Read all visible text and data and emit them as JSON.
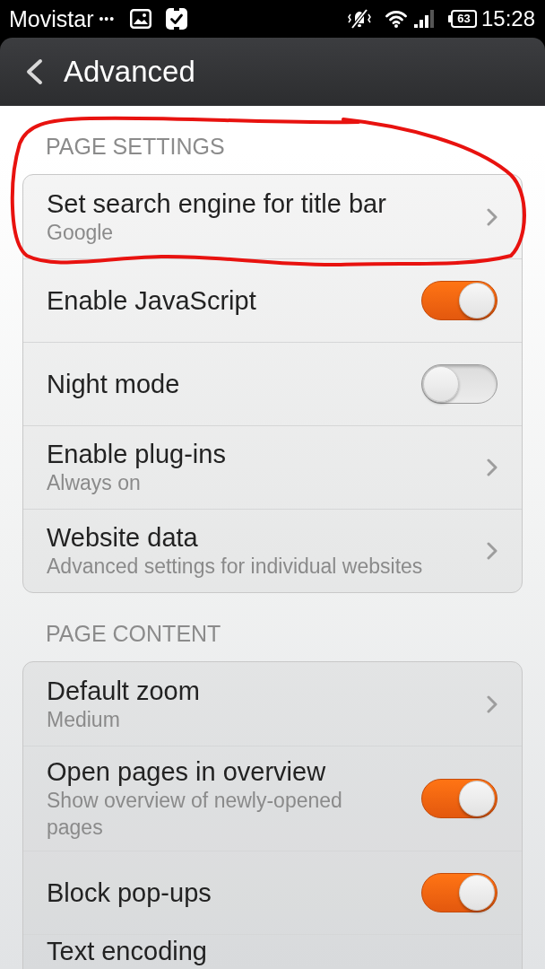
{
  "status_bar": {
    "carrier": "Movistar",
    "notification_dots": "•••",
    "battery": "63",
    "time": "15:28"
  },
  "title_bar": {
    "title": "Advanced"
  },
  "sections": [
    {
      "heading": "PAGE SETTINGS",
      "rows": [
        {
          "kind": "link",
          "title": "Set search engine for title bar",
          "subtitle": "Google"
        },
        {
          "kind": "toggle",
          "title": "Enable JavaScript",
          "on": true
        },
        {
          "kind": "toggle",
          "title": "Night mode",
          "on": false
        },
        {
          "kind": "link",
          "title": "Enable plug-ins",
          "subtitle": "Always on"
        },
        {
          "kind": "link",
          "title": "Website data",
          "subtitle": "Advanced settings for individual websites"
        }
      ]
    },
    {
      "heading": "PAGE CONTENT",
      "rows": [
        {
          "kind": "link",
          "title": "Default zoom",
          "subtitle": "Medium"
        },
        {
          "kind": "toggle",
          "title": "Open pages in overview",
          "subtitle": "Show overview of newly-opened pages",
          "on": true
        },
        {
          "kind": "toggle",
          "title": "Block pop-ups",
          "on": true
        },
        {
          "kind": "plain",
          "title": "Text encoding"
        }
      ]
    }
  ]
}
